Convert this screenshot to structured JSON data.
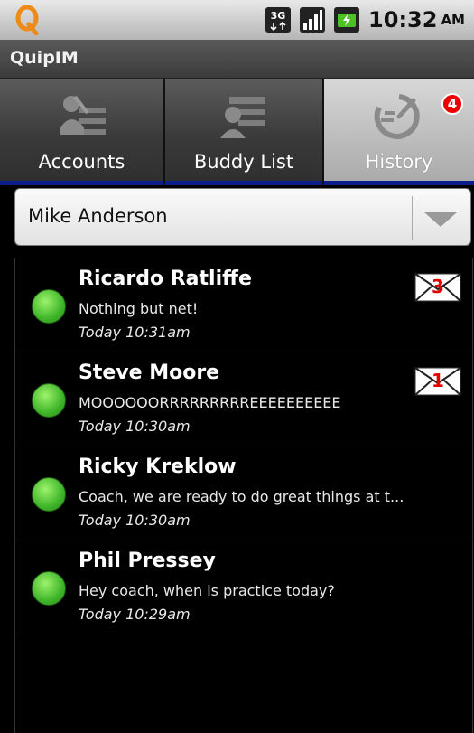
{
  "status_bar": {
    "time": "10:32",
    "ampm": "AM",
    "network_label": "3G"
  },
  "app": {
    "title": "QuipIM"
  },
  "tabs": [
    {
      "label": "Accounts"
    },
    {
      "label": "Buddy List"
    },
    {
      "label": "History",
      "badge": "4"
    }
  ],
  "account_selector": {
    "selected": "Mike Anderson"
  },
  "history": [
    {
      "name": "Ricardo Ratliffe",
      "message": "Nothing but net!",
      "time": "Today 10:31am",
      "unread": "3"
    },
    {
      "name": "Steve Moore",
      "message": "MOOOOOORRRRRRRRREEEEEEEEEE",
      "time": "Today 10:30am",
      "unread": "1"
    },
    {
      "name": "Ricky Kreklow",
      "message": "Coach, we are ready to do great things at t...",
      "time": "Today 10:30am",
      "unread": ""
    },
    {
      "name": "Phil Pressey",
      "message": "Hey coach, when is practice today?",
      "time": "Today 10:29am",
      "unread": ""
    }
  ],
  "colors": {
    "tab_underline": "#0a1e8c",
    "presence_online": "#3fb52a",
    "badge_red": "#e00000"
  }
}
